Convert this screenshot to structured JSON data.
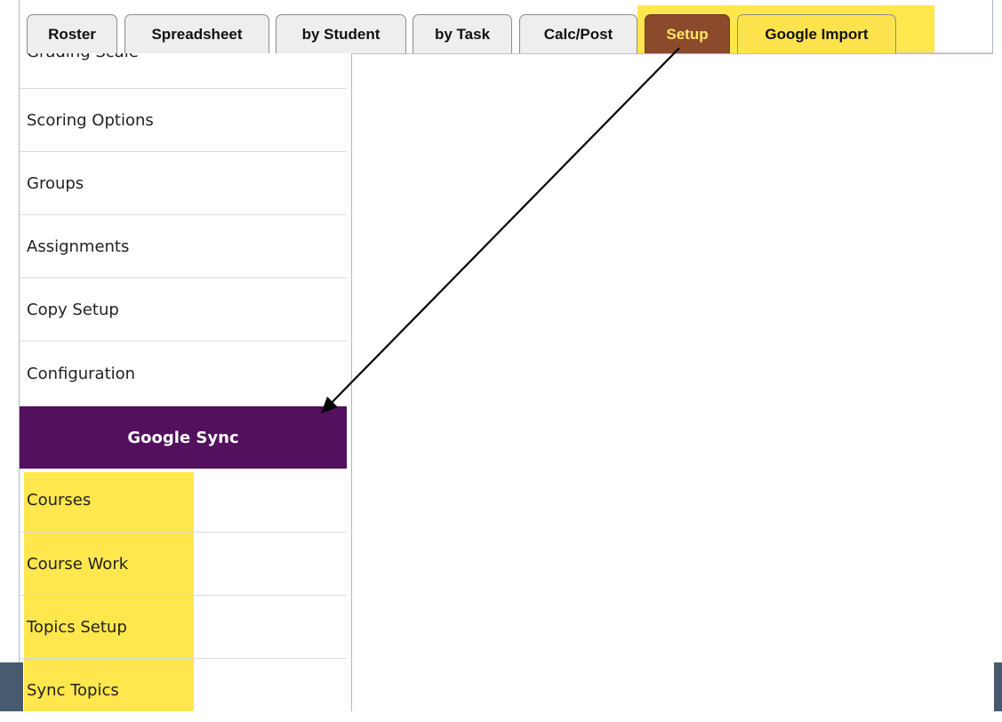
{
  "tabs": [
    {
      "label": "Roster"
    },
    {
      "label": "Spreadsheet"
    },
    {
      "label": "by Student"
    },
    {
      "label": "by Task"
    },
    {
      "label": "Calc/Post"
    },
    {
      "label": "Setup",
      "active": true
    },
    {
      "label": "Google Import"
    }
  ],
  "sidebar": {
    "items": [
      {
        "label": "Grading Scale"
      },
      {
        "label": "Scoring Options"
      },
      {
        "label": "Groups"
      },
      {
        "label": "Assignments"
      },
      {
        "label": "Copy Setup"
      },
      {
        "label": "Configuration"
      }
    ],
    "section_header": "Google Sync",
    "section_items": [
      {
        "label": "Courses"
      },
      {
        "label": "Course Work"
      },
      {
        "label": "Topics Setup"
      },
      {
        "label": "Sync Topics"
      }
    ]
  },
  "colors": {
    "active_tab_bg": "#8b4a2b",
    "active_tab_text": "#ffe66a",
    "section_header_bg": "#52105e",
    "highlight": "#ffe74d",
    "frame": "#475a6f"
  }
}
